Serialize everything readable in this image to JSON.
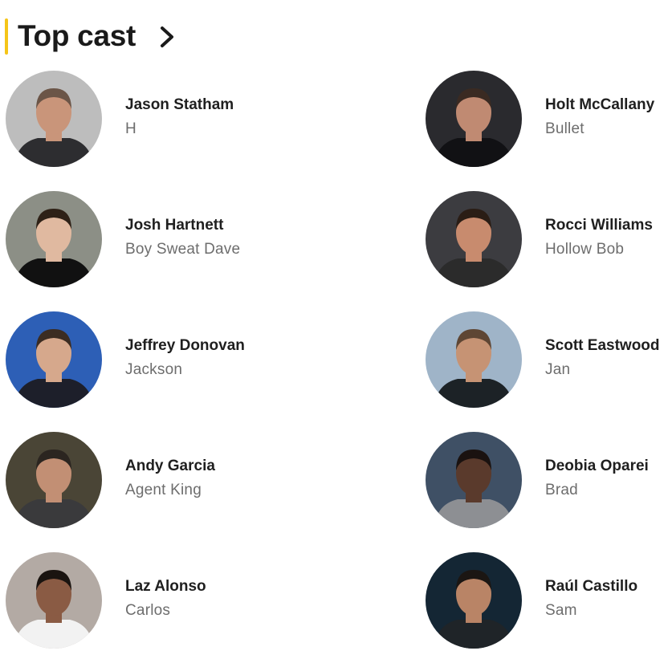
{
  "section": {
    "title": "Top cast",
    "accent_color": "#f5c518",
    "chevron_icon": "chevron-right-icon"
  },
  "cast": [
    {
      "name": "Jason Statham",
      "character": "H",
      "avatar_bg": "#bdbdbd",
      "skin": "#c9957a",
      "hair": "#6b5547",
      "clothes": "#2d2d30"
    },
    {
      "name": "Holt McCallany",
      "character": "Bullet",
      "avatar_bg": "#2a2a2e",
      "skin": "#c08a72",
      "hair": "#3a2a22",
      "clothes": "#111114"
    },
    {
      "name": "Josh Hartnett",
      "character": "Boy Sweat Dave",
      "avatar_bg": "#8c8f86",
      "skin": "#e0b9a0",
      "hair": "#2e2117",
      "clothes": "#111111"
    },
    {
      "name": "Rocci Williams",
      "character": "Hollow Bob",
      "avatar_bg": "#3c3c40",
      "skin": "#c88b6e",
      "hair": "#2a1d15",
      "clothes": "#2b2b2b"
    },
    {
      "name": "Jeffrey Donovan",
      "character": "Jackson",
      "avatar_bg": "#2d5fb6",
      "skin": "#d6a88c",
      "hair": "#3b2c22",
      "clothes": "#1d1f2a"
    },
    {
      "name": "Scott Eastwood",
      "character": "Jan",
      "avatar_bg": "#9fb4c8",
      "skin": "#c69374",
      "hair": "#5e4634",
      "clothes": "#1c2226"
    },
    {
      "name": "Andy Garcia",
      "character": "Agent King",
      "avatar_bg": "#4a4536",
      "skin": "#c28f74",
      "hair": "#2b2520",
      "clothes": "#3a3a3c"
    },
    {
      "name": "Deobia Oparei",
      "character": "Brad",
      "avatar_bg": "#3f5065",
      "skin": "#5a3a2c",
      "hair": "#1a1210",
      "clothes": "#8d8f93"
    },
    {
      "name": "Laz Alonso",
      "character": "Carlos",
      "avatar_bg": "#b3aaa4",
      "skin": "#8a5b44",
      "hair": "#1a1410",
      "clothes": "#f2f2f2"
    },
    {
      "name": "Raúl Castillo",
      "character": "Sam",
      "avatar_bg": "#142634",
      "skin": "#b98466",
      "hair": "#1b1613",
      "clothes": "#1f2428"
    }
  ]
}
